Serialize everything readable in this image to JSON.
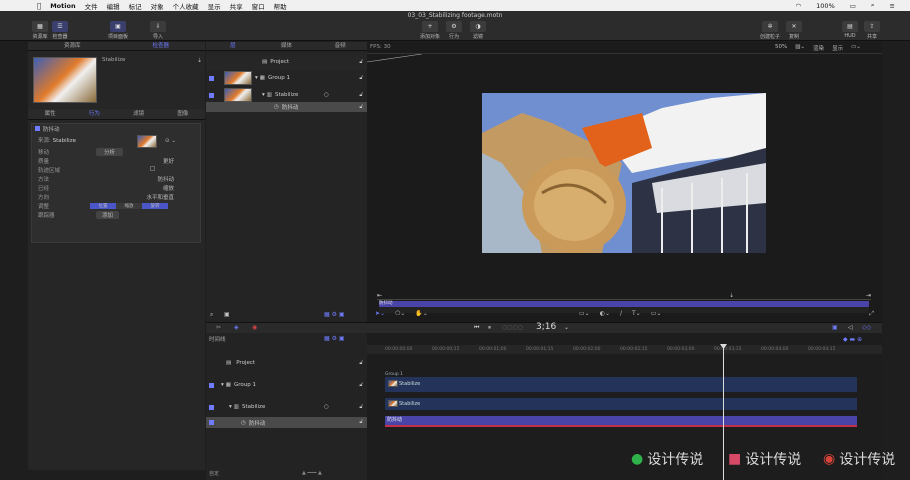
{
  "menubar": {
    "items": [
      "Motion",
      "文件",
      "编辑",
      "标记",
      "对象",
      "个人收藏",
      "显示",
      "共享",
      "窗口",
      "帮助"
    ],
    "right": "100%"
  },
  "window": {
    "title": "03_03_Stabilizing footage.motn"
  },
  "toolbar": {
    "library": "资源库",
    "inspector": "检查器",
    "project_panel": "项目面板",
    "import": "导入",
    "add_object": "添加对象",
    "behaviors": "行为",
    "filters": "滤镜",
    "make_particles": "创建粒子",
    "replicate": "复制",
    "hud": "HUD",
    "share": "共享"
  },
  "left_tabs": [
    "资源库",
    "检查器"
  ],
  "preview": {
    "name": "Stabilize"
  },
  "inspector_tabs": [
    "属性",
    "行为",
    "滤镜",
    "图像"
  ],
  "behavior": {
    "title": "防抖动",
    "source_label": "来源:",
    "source_value": "Stabilize",
    "move_label": "移动",
    "analyze": "分析",
    "rows": [
      {
        "l": "质量",
        "v": "更好"
      },
      {
        "l": "轨迹区域",
        "v": ""
      },
      {
        "l": "方法",
        "v": "防抖动"
      },
      {
        "l": "已经",
        "v": "缩放"
      },
      {
        "l": "方向",
        "v": "水平和垂直"
      }
    ],
    "adjust_label": "调整",
    "adjust_opts": [
      "位置",
      "缩放",
      "旋转"
    ],
    "track_label": "跟踪器",
    "track_btn": "添加"
  },
  "layers_tabs": [
    "层",
    "媒体",
    "音频"
  ],
  "layers": {
    "project": "Project",
    "group": "Group 1",
    "stabilize": "Stabilize",
    "behavior": "防抖动"
  },
  "canvas": {
    "fps": "FPS: 30",
    "zoom": "50%",
    "render": "渲染",
    "view": "显示"
  },
  "mini_tl": {
    "label": "防抖动"
  },
  "timing": {
    "timecode": "3;16"
  },
  "timeline": {
    "label": "时间线",
    "group": "Group 1",
    "stabilize": "Stabilize",
    "behavior": "防抖动",
    "custom": "自定",
    "ruler": [
      "00:00:00;00",
      "00:00:00;15",
      "00:00:01;00",
      "00:00:01;15",
      "00:00:02;00",
      "00:00:02;15",
      "00:00:03;00",
      "00:00:03;15",
      "00:00:04;00",
      "00:00:04;15"
    ]
  },
  "watermarks": [
    "设计传说",
    "设计传说",
    "设计传说"
  ]
}
